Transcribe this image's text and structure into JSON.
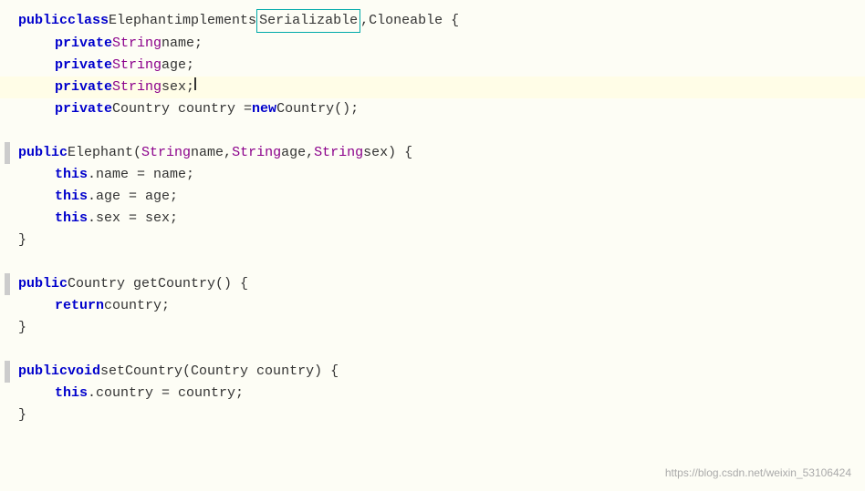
{
  "watermark": "https://blog.csdn.net/weixin_53106424",
  "lines": [
    {
      "id": "line1",
      "content": "class_declaration",
      "indent": 0,
      "highlighted": false,
      "has_bar": false
    }
  ]
}
